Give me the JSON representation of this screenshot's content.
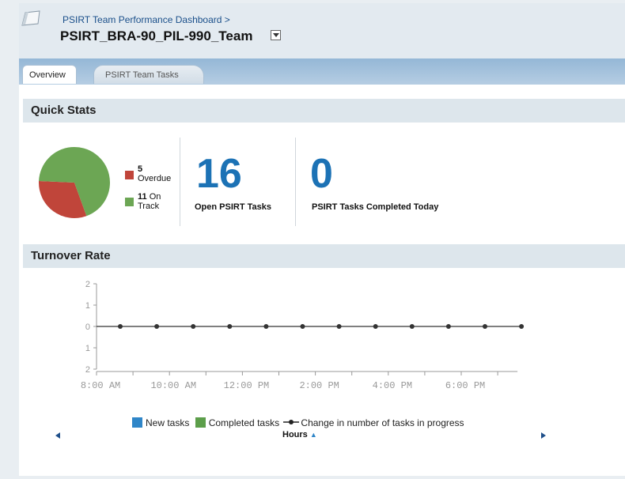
{
  "header": {
    "breadcrumb": "PSIRT Team Performance Dashboard >",
    "title": "PSIRT_BRA-90_PIL-990_Team"
  },
  "tabs": [
    {
      "label": "Overview",
      "active": true
    },
    {
      "label": "PSIRT Team Tasks",
      "active": false
    }
  ],
  "quick_stats": {
    "heading": "Quick Stats",
    "overdue_count": "5",
    "overdue_label": "Overdue",
    "on_track_count": "11",
    "on_track_label_1": "On",
    "on_track_label_2": "Track",
    "open_tasks": "16",
    "open_tasks_label": "Open PSIRT Tasks",
    "completed_today": "0",
    "completed_today_label": "PSIRT Tasks Completed Today",
    "colors": {
      "overdue": "#c0453a",
      "on_track": "#6ca654"
    }
  },
  "turnover": {
    "heading": "Turnover Rate",
    "legend_new": "New tasks",
    "legend_completed": "Completed tasks",
    "legend_change": "Change in number of tasks in progress",
    "hours_label": "Hours"
  },
  "chart_data": [
    {
      "type": "pie",
      "labels": [
        "Overdue",
        "On Track"
      ],
      "values": [
        5,
        11
      ],
      "colors": [
        "#c0453a",
        "#6ca654"
      ]
    },
    {
      "type": "line",
      "x": [
        "8:00 AM",
        "9:00 AM",
        "10:00 AM",
        "11:00 AM",
        "12:00 PM",
        "1:00 PM",
        "2:00 PM",
        "3:00 PM",
        "4:00 PM",
        "5:00 PM",
        "6:00 PM",
        "7:00 PM"
      ],
      "x_tick_labels": [
        "8:00 AM",
        "10:00 AM",
        "12:00 PM",
        "2:00 PM",
        "4:00 PM",
        "6:00 PM"
      ],
      "y_tick_labels": [
        "2",
        "1",
        "0",
        "1",
        "2"
      ],
      "ylim": [
        -2,
        2
      ],
      "xlabel": "Hours",
      "series": [
        {
          "name": "New tasks",
          "values": [],
          "color": "#2f86c8"
        },
        {
          "name": "Completed tasks",
          "values": [],
          "color": "#5c9e4a"
        },
        {
          "name": "Change in number of tasks in progress",
          "values": [
            0,
            0,
            0,
            0,
            0,
            0,
            0,
            0,
            0,
            0,
            0,
            0
          ],
          "color": "#333333"
        }
      ],
      "legend_position": "bottom",
      "grid": false
    }
  ]
}
